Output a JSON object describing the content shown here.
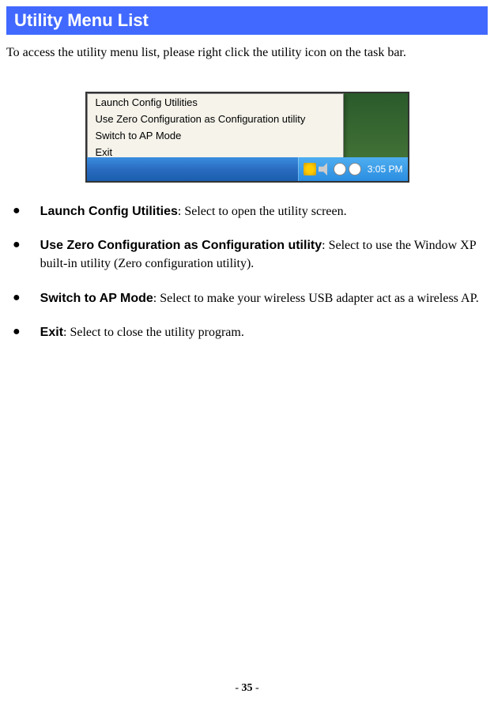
{
  "header": {
    "title": "Utility Menu List"
  },
  "intro": "To access the utility menu list, please right click the utility icon on the task bar.",
  "screenshot": {
    "menu_items": [
      "Launch Config Utilities",
      "Use Zero Configuration as Configuration utility",
      "Switch to AP Mode",
      "Exit"
    ],
    "clock": "3:05 PM"
  },
  "bullets": [
    {
      "title": "Launch Config Utilities",
      "desc": ": Select to open the utility screen."
    },
    {
      "title": "Use Zero Configuration as Configuration utility",
      "desc": ": Select to use the Window XP built-in utility (Zero configuration utility)."
    },
    {
      "title": "Switch to AP Mode",
      "desc": ": Select to make your wireless USB adapter act as a wireless AP."
    },
    {
      "title": "Exit",
      "desc": ": Select to close the utility program."
    }
  ],
  "footer": {
    "prefix": "- ",
    "page": "35",
    "suffix": " -"
  }
}
